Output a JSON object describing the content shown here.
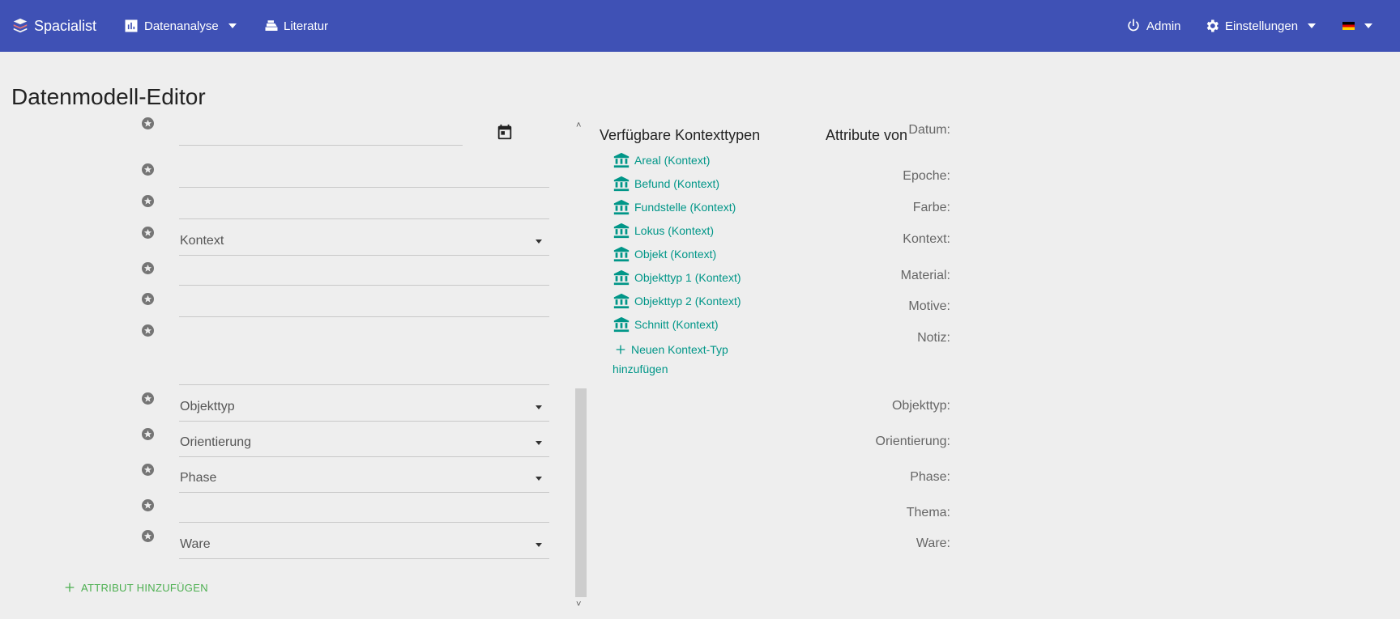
{
  "navbar": {
    "brand": "Spacialist",
    "data_analysis": "Datenanalyse",
    "literature": "Literatur",
    "user": "Admin",
    "settings": "Einstellungen"
  },
  "page": {
    "title": "Datenmodell-Editor"
  },
  "attributes": [
    {
      "label": "Datum:",
      "type": "date",
      "value": ""
    },
    {
      "label": "Epoche:",
      "type": "text",
      "value": ""
    },
    {
      "label": "Farbe:",
      "type": "text",
      "value": ""
    },
    {
      "label": "Kontext:",
      "type": "select",
      "value": "Kontext"
    },
    {
      "label": "Material:",
      "type": "text",
      "value": ""
    },
    {
      "label": "Motive:",
      "type": "text",
      "value": ""
    },
    {
      "label": "Notiz:",
      "type": "textarea",
      "value": ""
    },
    {
      "label": "Objekttyp:",
      "type": "select",
      "value": "Objekttyp"
    },
    {
      "label": "Orientierung:",
      "type": "select",
      "value": "Orientierung"
    },
    {
      "label": "Phase:",
      "type": "select",
      "value": "Phase"
    },
    {
      "label": "Thema:",
      "type": "text",
      "value": ""
    },
    {
      "label": "Ware:",
      "type": "select",
      "value": "Ware"
    }
  ],
  "add_attribute": "ATTRIBUT HINZUFÜGEN",
  "context_types": {
    "title": "Verfügbare Kontexttypen",
    "items": [
      "Areal (Kontext)",
      "Befund (Kontext)",
      "Fundstelle (Kontext)",
      "Lokus (Kontext)",
      "Objekt (Kontext)",
      "Objekttyp 1 (Kontext)",
      "Objekttyp 2 (Kontext)",
      "Schnitt (Kontext)"
    ],
    "add_label": "Neuen Kontext-Typ hinzufügen"
  },
  "attributes_of": {
    "title": "Attribute von"
  },
  "colors": {
    "navbar": "#3f51b5",
    "link": "#009688",
    "add": "#4caf50"
  },
  "icons": [
    "brand-logo-icon",
    "bar-chart-icon",
    "books-icon",
    "power-icon",
    "gear-icon",
    "german-flag-icon",
    "star-icon",
    "calendar-icon",
    "bank-icon",
    "plus-icon"
  ]
}
